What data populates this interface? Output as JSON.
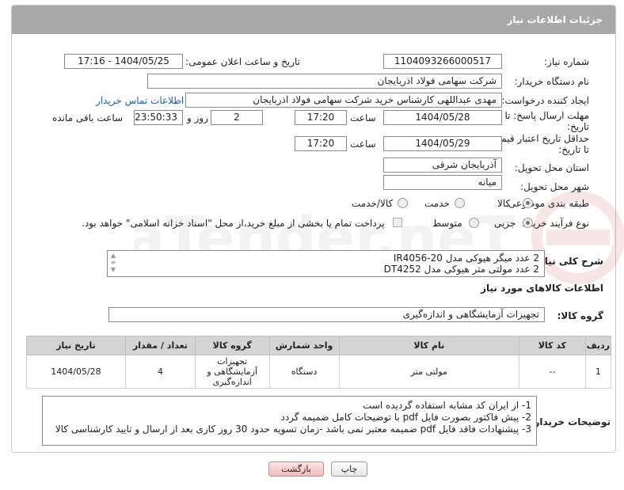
{
  "header": {
    "title": "جزئیات اطلاعات نیاز"
  },
  "fields": {
    "need_number_label": "شماره نیاز:",
    "need_number": "1104093266000517",
    "announce_label": "تاریخ و ساعت اعلان عمومی:",
    "announce_value": "1404/05/25 - 17:16",
    "buyer_org_label": "نام دستگاه خریدار:",
    "buyer_org": "شرکت سهامی فولاد اذربایجان",
    "creator_label": "ایجاد کننده درخواست:",
    "creator": "مهدی عبداللهی کارشناس خرید شرکت سهامی فولاد اذربایجان",
    "contact_link": "اطلاعات تماس خریدار",
    "deadline_label_1": "مهلت ارسال پاسخ: تا",
    "deadline_label_2": "تاریخ:",
    "deadline_date": "1404/05/28",
    "hour_label": "ساعت",
    "deadline_time": "17:20",
    "days_value": "2",
    "days_label": "روز و",
    "remaining_time": "23:50:33",
    "remaining_label": "ساعت باقی مانده",
    "validity_label_1": "حداقل تاریخ اعتبار قیمت:",
    "validity_label_2": "تا تاریخ:",
    "validity_date": "1404/05/29",
    "validity_time": "17:20",
    "province_label": "استان محل تحویل:",
    "province": "آذربایجان شرقی",
    "city_label": "شهر محل تحویل:",
    "city": "میانه",
    "category_label": "طبقه بندی موضوعی:",
    "category_options": [
      "کالا",
      "خدمت",
      "کالا/خدمت"
    ],
    "process_label": "نوع فرآیند خرید :",
    "process_options": [
      "جزیی",
      "متوسط"
    ],
    "payment_note": "پرداخت تمام یا بخشی از مبلغ خرید،از محل \"اسناد خزانه اسلامی\" خواهد بود."
  },
  "description": {
    "label": "شرح کلی نیاز:",
    "lines": [
      "2 عدد میگر هیوکی مدل IR4056-20",
      "2 عدد مولتی متر هیوکی مدل DT4252"
    ]
  },
  "goods": {
    "section_title": "اطلاعات کالاهای مورد نیاز",
    "group_label": "گروه کالا:",
    "group_value": "تجهیزات آزمایشگاهی و اندازه‌گیری",
    "columns": [
      "ردیف",
      "کد کالا",
      "نام کالا",
      "واحد شمارش",
      "گروه کالا",
      "تعداد / مقدار",
      "تاریخ نیاز"
    ],
    "rows": [
      {
        "row": "1",
        "code": "--",
        "name": "مولتی متر",
        "unit": "دستگاه",
        "group": "تجهیزات آزمایشگاهی و اندازه‌گیری",
        "qty": "4",
        "date": "1404/05/28"
      }
    ]
  },
  "notes": {
    "label": "توضیحات خریدار:",
    "lines": [
      "1- از ایران کد مشابه استفاده گردیده است",
      "2- پیش فاکتور بصورت فایل pdf با توضیحات کامل ضمیمه گردد",
      "3- پیشنهادات فاقد فایل pdf  ضمیمه معتبر نمی باشد -زمان تسویه حدود 30  روز کاری بعد از ارسال و تایید کارشناسی کالا"
    ]
  },
  "buttons": {
    "print": "چاپ",
    "back": "بازگشت"
  },
  "colors": {
    "header_bg": "#a8a8a8",
    "link": "#1a5fb4",
    "back_button": "#f3bcbc"
  }
}
